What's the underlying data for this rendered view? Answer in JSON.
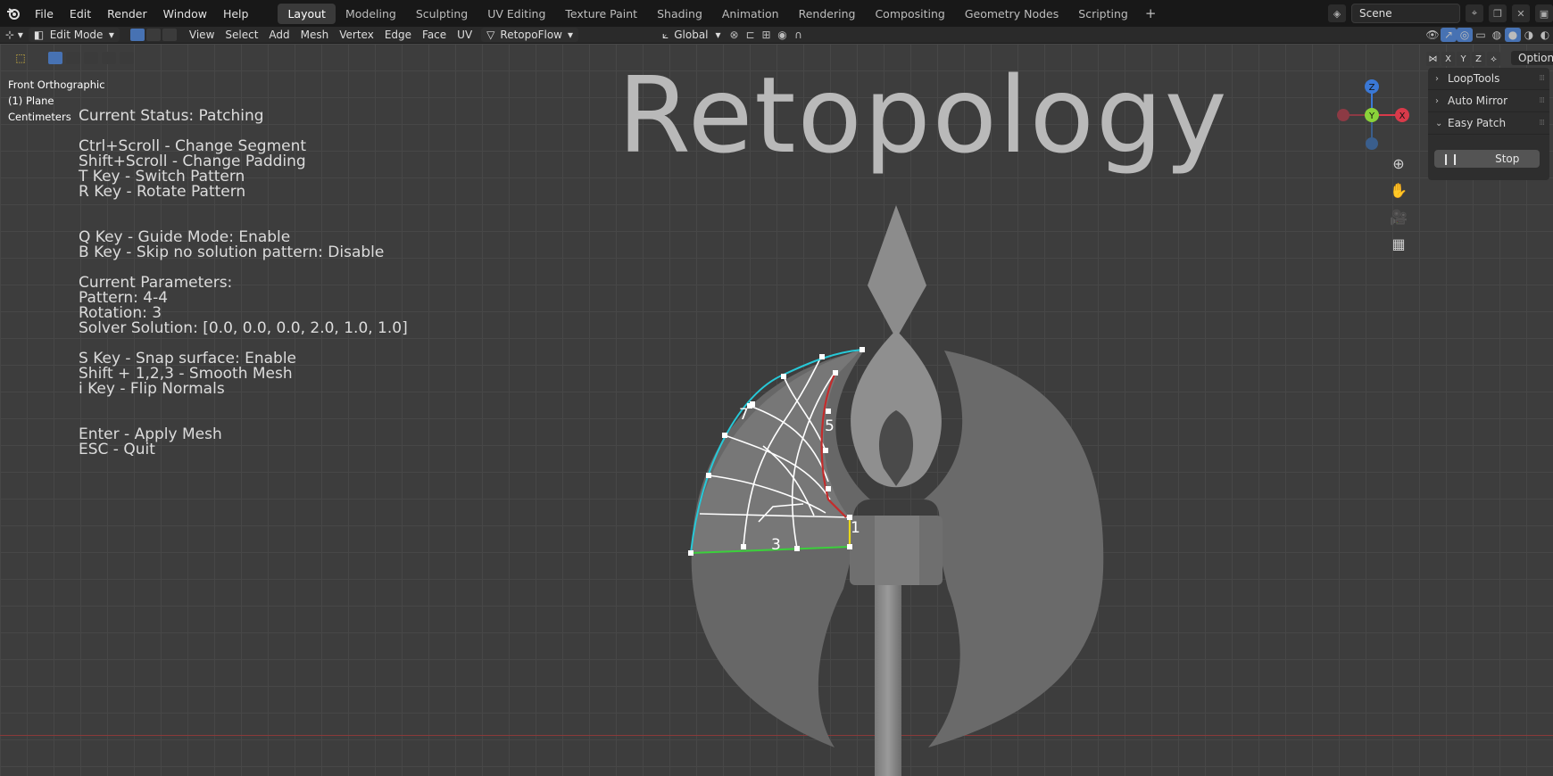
{
  "topbar": {
    "menus": [
      "File",
      "Edit",
      "Render",
      "Window",
      "Help"
    ],
    "workspaces": [
      "Layout",
      "Modeling",
      "Sculpting",
      "UV Editing",
      "Texture Paint",
      "Shading",
      "Animation",
      "Rendering",
      "Compositing",
      "Geometry Nodes",
      "Scripting"
    ],
    "active_workspace": "Layout",
    "add_tab": "+",
    "scene_name": "Scene"
  },
  "header": {
    "mode": "Edit Mode",
    "menus": [
      "View",
      "Select",
      "Add",
      "Mesh",
      "Vertex",
      "Edge",
      "Face",
      "UV"
    ],
    "addon": "RetopoFlow",
    "orientation": "Global"
  },
  "viewport": {
    "view_name": "Front Orthographic",
    "object": "(1) Plane",
    "units": "Centimeters",
    "title": "Retopology",
    "status_lines": [
      "Current Status: Patching",
      "",
      "Ctrl+Scroll - Change Segment",
      "Shift+Scroll - Change Padding",
      "T Key - Switch Pattern",
      "R Key - Rotate Pattern",
      "",
      "",
      "Q Key - Guide Mode: Enable",
      "B Key - Skip no solution pattern: Disable",
      "",
      "Current Parameters:",
      "Pattern: 4-4",
      "Rotation: 3",
      "Solver Solution: [0.0, 0.0, 0.0, 2.0, 1.0, 1.0]",
      "",
      "S Key - Snap surface: Enable",
      "Shift + 1,2,3 - Smooth Mesh",
      "i Key - Flip Normals",
      "",
      "",
      "Enter - Apply Mesh",
      "ESC - Quit"
    ],
    "edge_labels": {
      "left": "7",
      "right": "5",
      "bottom": "3",
      "corner": "1"
    }
  },
  "gizmo": {
    "z": "Z",
    "y": "Y",
    "x": "X"
  },
  "sidebar": {
    "axes": [
      "X",
      "Y",
      "Z"
    ],
    "options_label": "Options",
    "panels": [
      {
        "label": "LoopTools",
        "open": false
      },
      {
        "label": "Auto Mirror",
        "open": false
      },
      {
        "label": "Easy Patch",
        "open": true
      }
    ],
    "stop_label": "Stop"
  },
  "colors": {
    "accent": "#4772b3",
    "cyan_edge": "#27c9d8",
    "red_edge": "#c42c2c",
    "green_edge": "#3ccf3c",
    "yellow_edge": "#e8d81a"
  }
}
